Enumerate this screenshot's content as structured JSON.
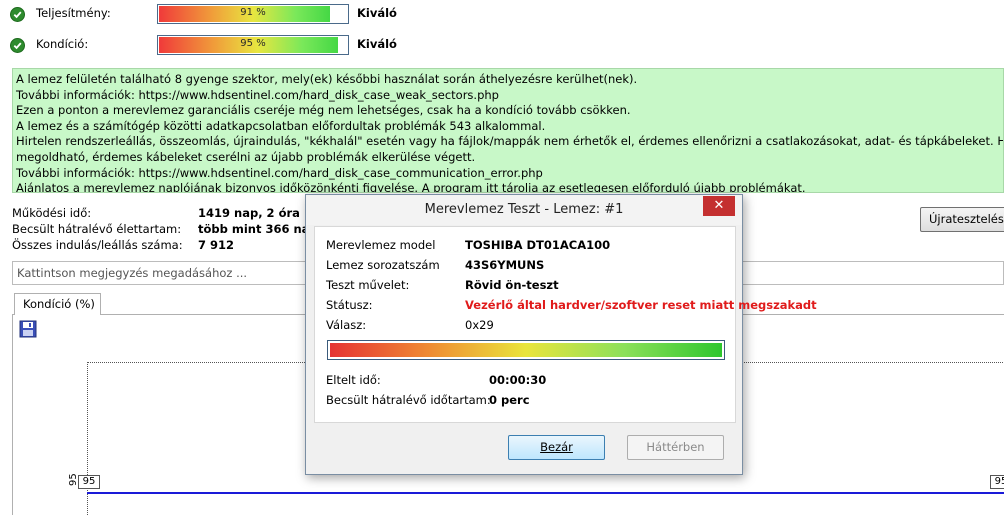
{
  "health": {
    "performance": {
      "label": "Teljesítmény:",
      "percent": 91,
      "text": "91 %",
      "status": "Kiváló"
    },
    "condition": {
      "label": "Kondíció:",
      "percent": 95,
      "text": "95 %",
      "status": "Kiváló"
    }
  },
  "info_lines": [
    "A lemez felületén található 8 gyenge szektor, mely(ek) későbbi használat során áthelyezésre kerülhet(nek).",
    "További információk: https://www.hdsentinel.com/hard_disk_case_weak_sectors.php",
    "Ezen a ponton a merevlemez garanciális cseréje még nem lehetséges, csak ha a kondíció tovább csökken.",
    "A lemez és a számítógép közötti adatkapcsolatban előfordultak problémák 543 alkalommal.",
    "Hirtelen rendszerleállás, összeomlás, újraindulás, \"kékhalál\" esetén vagy ha fájlok/mappák nem érhetők el, érdemes ellenőrizni a csatlakozásokat, adat- és tápkábeleket. Ha",
    "megoldható, érdemes kábeleket cserélni az újabb problémák elkerülése végett.",
    "További információk: https://www.hdsentinel.com/hard_disk_case_communication_error.php",
    "Ajánlatos a merevlemez naplójának bizonyos időközönkénti figyelése. A program itt tárolja az esetlegesen előforduló újabb problémákat."
  ],
  "stats": {
    "uptime_label": "Működési idő:",
    "uptime_value": "1419 nap, 2 óra",
    "remaining_label": "Becsült hátralévő élettartam:",
    "remaining_value": "több mint 366 nap",
    "startstop_label": "Összes indulás/leállás száma:",
    "startstop_value": "7 912"
  },
  "retest_button": "Újratesztelés",
  "comment_placeholder": "Kattintson megjegyzés megadásához ...",
  "tab_label": "Kondíció  (%)",
  "graph": {
    "value_label_left": "95",
    "value_label_right": "95",
    "y_axis_label": "95"
  },
  "dialog": {
    "title": "Merevlemez Teszt - Lemez: #1",
    "close": "✕",
    "model_label": "Merevlemez model",
    "model_value": "TOSHIBA DT01ACA100",
    "serial_label": "Lemez sorozatszám",
    "serial_value": "43S6YMUNS",
    "operation_label": "Teszt művelet:",
    "operation_value": "Rövid ön-teszt",
    "status_label": "Státusz:",
    "status_value": "Vezérlő által hardver/szoftver reset miatt megszakadt",
    "response_label": "Válasz:",
    "response_value": "0x29",
    "progress_percent": 100,
    "elapsed_label": "Eltelt idő:",
    "elapsed_value": "00:00:30",
    "remaining_label": "Becsült hátralévő időtartam:",
    "remaining_value": "0 perc",
    "close_button": "Bezár",
    "background_button": "Háttérben"
  },
  "colors": {
    "info_bg": "#c8f8c8",
    "status_red": "#e01b1b",
    "graph_line": "#1a1ad8",
    "close_red": "#c43030"
  }
}
